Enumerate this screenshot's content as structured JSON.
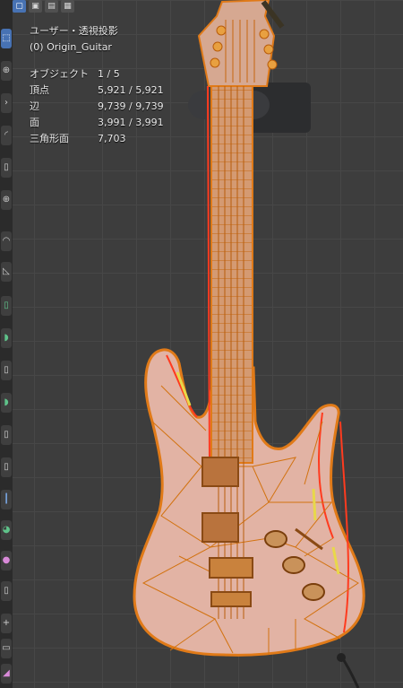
{
  "viewport": {
    "view_name": "ユーザー・透視投影",
    "object_name": "(0) Origin_Guitar"
  },
  "stats": [
    {
      "label": "オブジェクト",
      "value": "1 / 5"
    },
    {
      "label": "頂点",
      "value": "5,921 / 5,921"
    },
    {
      "label": "辺",
      "value": "9,739 / 9,739"
    },
    {
      "label": "面",
      "value": "3,991 / 3,991"
    },
    {
      "label": "三角形面",
      "value": "7,703"
    }
  ],
  "header": {
    "modes": [
      "select-box-icon",
      "mode-extend-icon",
      "mode-subtract-icon",
      "mode-intersect-icon"
    ]
  },
  "toolbar": {
    "tools": [
      "select-icon",
      "cursor-icon",
      "move-icon",
      "rotate-icon",
      "scale-icon",
      "transform-icon",
      "annotate-icon",
      "measure-icon",
      "add-cube-icon",
      "extrude-icon",
      "inset-icon",
      "bevel-icon",
      "loop-cut-icon",
      "knife-icon",
      "poly-build-icon",
      "spin-icon",
      "smooth-icon",
      "edge-slide-icon",
      "shrink-icon",
      "shear-icon",
      "rip-icon"
    ]
  },
  "colors": {
    "background": "#3d3d3d",
    "wire": "#e07a18",
    "selected_face": "#e2b3a4",
    "active_edge": "#ff3b1f"
  }
}
